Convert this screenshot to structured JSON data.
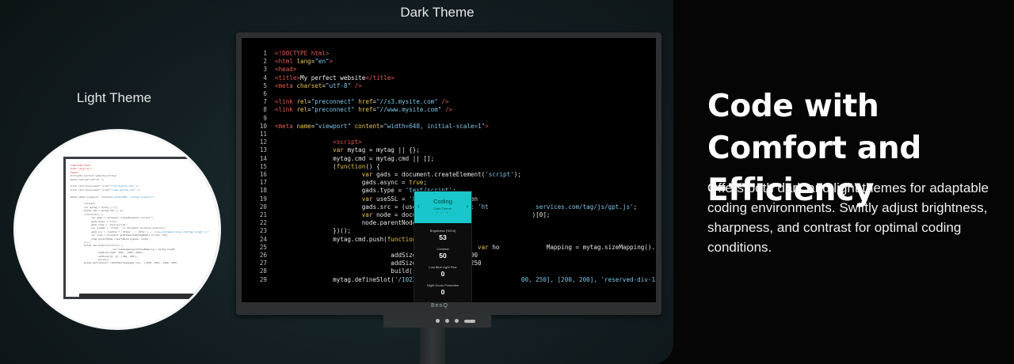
{
  "labels": {
    "dark": "Dark Theme",
    "light": "Light Theme"
  },
  "headline": "Code with Comfort and Efficiency",
  "description": "Offers both dark and light themes for adaptable coding environments. Swiftly adjust brightness, sharpness, and contrast for optimal coding conditions.",
  "monitor": {
    "brand": "BenQ"
  },
  "osd": {
    "mode": "Coding",
    "mode_sub": "Dark Theme",
    "dots": "• • •",
    "settings": [
      {
        "label": "Brightness (%/Cd)",
        "value": "53"
      },
      {
        "label": "Contrast",
        "value": "50"
      },
      {
        "label": "Low Blue Light Plus",
        "value": "0"
      },
      {
        "label": "Night Hours Protection",
        "value": "0"
      }
    ]
  },
  "colors": {
    "accent": "#19c6cc",
    "background": "#050505"
  }
}
